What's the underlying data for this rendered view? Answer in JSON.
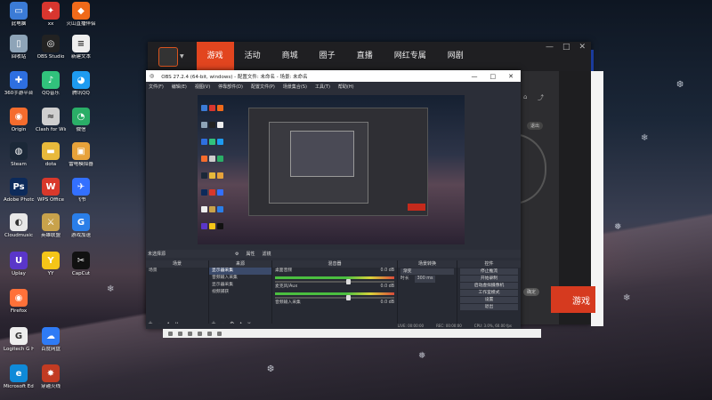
{
  "desktop_icons": [
    {
      "label": "此电脑",
      "color": "#3b7bd6",
      "glyph": "▭"
    },
    {
      "label": "xx",
      "color": "#d8362f",
      "glyph": "✦"
    },
    {
      "label": "火山直播伴侣",
      "color": "#f06a1a",
      "glyph": "◆"
    },
    {
      "label": "回收站",
      "color": "#8ea4b8",
      "glyph": "▯"
    },
    {
      "label": "OBS Studio",
      "color": "#222",
      "glyph": "◎"
    },
    {
      "label": "新建文本",
      "color": "#eeeeee",
      "glyph": "≡"
    },
    {
      "label": "360手游平台",
      "color": "#2e6fe0",
      "glyph": "✚"
    },
    {
      "label": "QQ音乐",
      "color": "#31c27c",
      "glyph": "♪"
    },
    {
      "label": "腾讯QQ",
      "color": "#1e9bf0",
      "glyph": "◕"
    },
    {
      "label": "Origin",
      "color": "#f56c2d",
      "glyph": "◉"
    },
    {
      "label": "Clash for Windows",
      "color": "#cfcfcf",
      "glyph": "≈"
    },
    {
      "label": "微信",
      "color": "#2aae67",
      "glyph": "◔"
    },
    {
      "label": "Steam",
      "color": "#1b2838",
      "glyph": "◍"
    },
    {
      "label": "dota",
      "color": "#e8b93b",
      "glyph": "▬"
    },
    {
      "label": "雷电模拟器",
      "color": "#e7a23a",
      "glyph": "▣"
    },
    {
      "label": "Adobe Photoshop",
      "color": "#0c2a5a",
      "glyph": "Ps"
    },
    {
      "label": "WPS Office",
      "color": "#d9382b",
      "glyph": "W"
    },
    {
      "label": "飞书",
      "color": "#3370ff",
      "glyph": "✈"
    },
    {
      "label": "Cloudmusic",
      "color": "#e8e8e8",
      "glyph": "◐"
    },
    {
      "label": "英雄联盟",
      "color": "#c8a24b",
      "glyph": "⚔"
    },
    {
      "label": "游戏加速",
      "color": "#2a7ee8",
      "glyph": "G"
    },
    {
      "label": "Uplay",
      "color": "#5a36c9",
      "glyph": "U"
    },
    {
      "label": "YY",
      "color": "#f5c518",
      "glyph": "Y"
    },
    {
      "label": "CapCut",
      "color": "#111",
      "glyph": "✂"
    },
    {
      "label": "Firefox",
      "color": "#ff7139",
      "glyph": "◉"
    },
    {
      "label": "Logitech G HUB",
      "color": "#eeeeee",
      "glyph": "G"
    },
    {
      "label": "百度网盘",
      "color": "#2f7bf5",
      "glyph": "☁"
    },
    {
      "label": "Microsoft Edge",
      "color": "#0f8ad8",
      "glyph": "e"
    },
    {
      "label": "穿越火线",
      "color": "#c23b22",
      "glyph": "✸"
    }
  ],
  "stream_app": {
    "nav": [
      "游戏",
      "活动",
      "商城",
      "圈子",
      "直播",
      "网红专属",
      "网剧"
    ],
    "active_tab": "游戏",
    "window_buttons": [
      "—",
      "□",
      "✕"
    ],
    "side_button": "退出",
    "start_label": "游戏",
    "dialog_button": "确定"
  },
  "obs": {
    "title": "OBS 27.2.4 (64-bit, windows) - 配置文件: 未命名 - 场景: 未命名",
    "window_buttons": [
      "—",
      "□",
      "✕"
    ],
    "menu": [
      "文件(F)",
      "编辑(E)",
      "视图(V)",
      "停靠部件(D)",
      "配置文件(P)",
      "场景集合(S)",
      "工具(T)",
      "帮助(H)"
    ],
    "scene_bar": [
      "未选择源",
      "属性",
      "滤镜"
    ],
    "docks": {
      "scenes": {
        "title": "场景",
        "items": [
          "场景"
        ]
      },
      "sources": {
        "title": "来源",
        "items": [
          "显示器采集",
          "音频输入采集",
          "显示器采集",
          "视频捕获"
        ]
      },
      "mixer": {
        "title": "混音器",
        "channels": [
          "桌面音频",
          "麦克风/Aux",
          "音频输入采集"
        ],
        "levels": [
          "0.0 dB",
          "0.0 dB",
          "0.0 dB"
        ]
      },
      "transitions": {
        "title": "场景转换",
        "type": "渐变",
        "duration_label": "时长",
        "duration": "300 ms"
      },
      "controls": {
        "title": "控件",
        "buttons": [
          "停止推流",
          "开始录制",
          "启动虚拟摄像机",
          "工作室模式",
          "设置",
          "退出"
        ]
      }
    },
    "status": [
      "LIVE: 00:00:00",
      "REC: 00:00:00",
      "CPU: 3.0%, 60.00 fps"
    ]
  }
}
